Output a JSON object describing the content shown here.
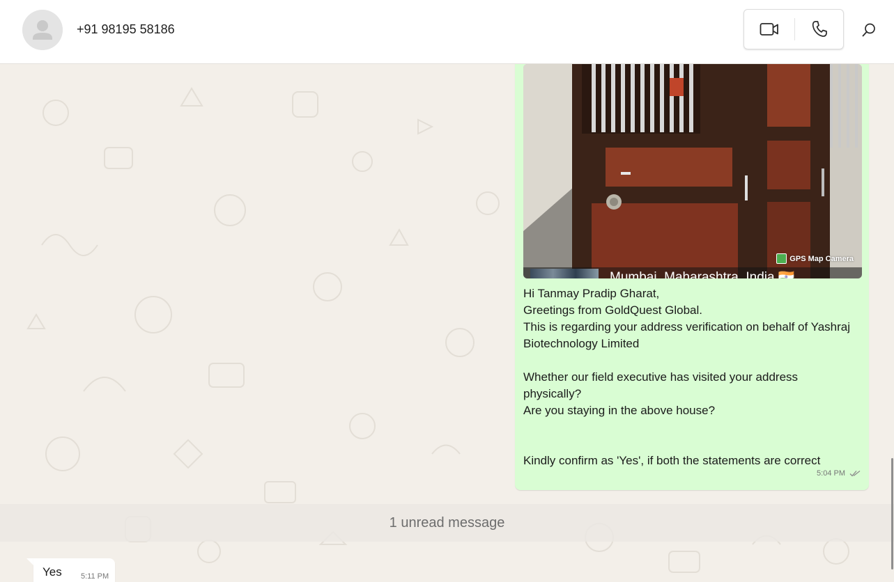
{
  "header": {
    "contact_name": "+91 98195 58186",
    "icons": {
      "avatar": "person-placeholder-icon",
      "video": "video-camera-icon",
      "voice": "phone-icon",
      "search": "search-icon"
    }
  },
  "outgoing_message": {
    "image": {
      "watermark": "GPS Map Camera",
      "location": "Mumbai, Maharashtra, India 🇮🇳"
    },
    "paragraphs": [
      "Hi Tanmay Pradip Gharat,\nGreetings from GoldQuest Global.\nThis is regarding your address verification on behalf of Yashraj Biotechnology Limited",
      "Whether our field executive has visited your address physically?\nAre you staying in the above house?",
      "Kindly confirm as 'Yes', if both the statements are correct"
    ],
    "time": "5:04 PM",
    "status_icon": "double-check-icon"
  },
  "unread_banner": "1 unread message",
  "incoming_message": {
    "text": "Yes",
    "time": "5:11 PM"
  },
  "colors": {
    "outgoing_bubble": "#d9fdd3",
    "incoming_bubble": "#ffffff",
    "chat_background": "#f3efe9"
  }
}
